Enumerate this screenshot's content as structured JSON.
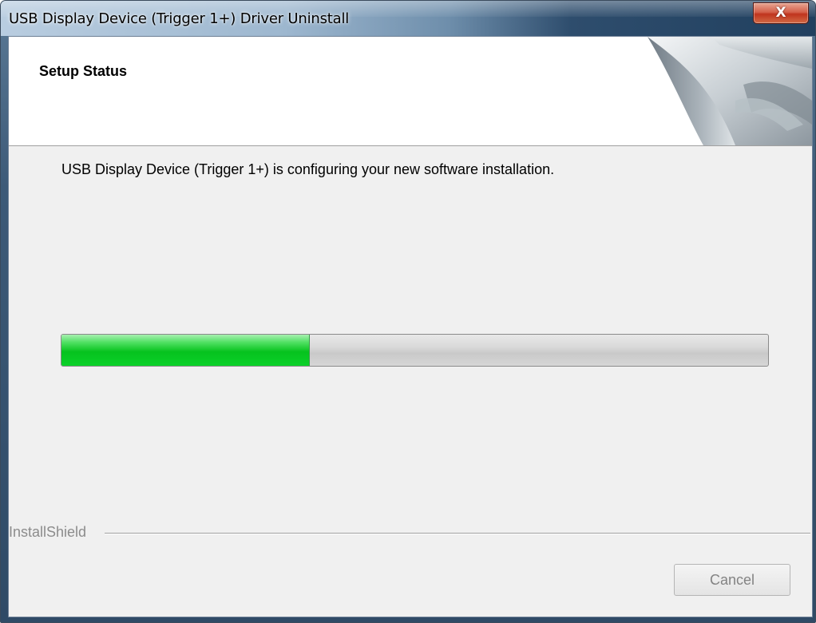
{
  "window": {
    "title": "USB Display Device (Trigger 1+) Driver Uninstall",
    "close_glyph": "X"
  },
  "header": {
    "title": "Setup Status",
    "graphic_icon": "page-curl-graphic"
  },
  "main": {
    "status_message": "USB Display Device (Trigger 1+) is configuring your new software installation.",
    "progress_percent": 35
  },
  "footer": {
    "brand_label": "InstallShield",
    "cancel_label": "Cancel",
    "cancel_enabled": false
  },
  "colors": {
    "progress_fill": "#06c21e",
    "close_button": "#c0341e",
    "disabled_text": "#838383"
  }
}
